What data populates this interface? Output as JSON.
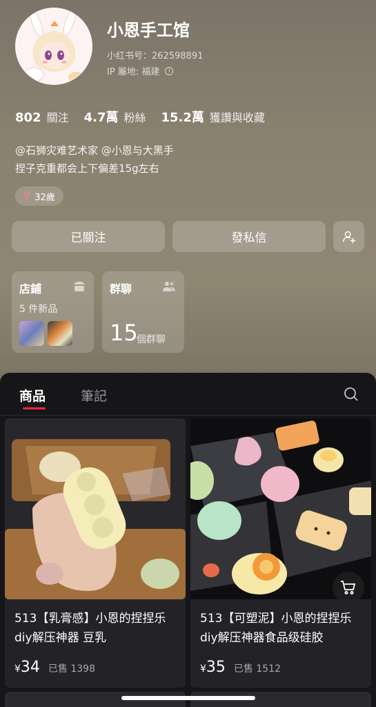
{
  "profile": {
    "name": "小恩手工馆",
    "red_id": "小红书号：262598891",
    "ip_location": "IP 屬地: 福建",
    "stats": [
      {
        "num": "802",
        "label": "關注"
      },
      {
        "num": "4.7萬",
        "label": "粉絲"
      },
      {
        "num": "15.2萬",
        "label": "獲讚與收藏"
      }
    ],
    "bio_line1": "@石狮灾难艺术家 @小恩与大黑手",
    "bio_line2": "捏子克重都会上下偏差15g左右",
    "age_tag": "32歲"
  },
  "actions": {
    "follow_label": "已關注",
    "message_label": "發私信"
  },
  "cards": {
    "shop_title": "店鋪",
    "shop_sub": "5 件新品",
    "group_title": "群聊",
    "group_count": "15",
    "group_label": "個群聊"
  },
  "tabs": {
    "goods": "商品",
    "notes": "筆記"
  },
  "products": [
    {
      "title": "513【乳膏感】小恩的捏捏乐diy解压神器 豆乳",
      "price_symbol": "¥",
      "price": "34",
      "sold": "已售 1398"
    },
    {
      "title": "513【可塑泥】小恩的捏捏乐diy解压神器食品级硅胶",
      "price_symbol": "¥",
      "price": "35",
      "sold": "已售 1512"
    }
  ],
  "colors": {
    "accent": "#ff2442",
    "panel_bg": "#161619"
  }
}
